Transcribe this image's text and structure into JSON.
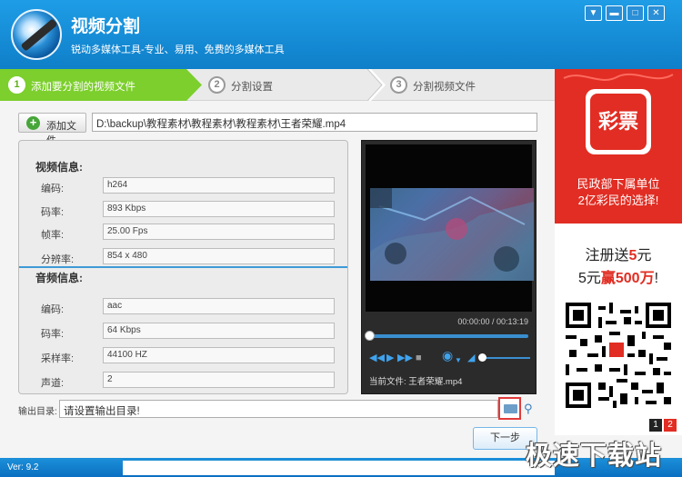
{
  "app": {
    "title": "视频分割",
    "subtitle": "锐动多媒体工具-专业、易用、免费的多媒体工具",
    "window_controls": [
      "menu-icon",
      "minimize-icon",
      "maximize-icon",
      "close-icon"
    ]
  },
  "steps": [
    {
      "num": "1",
      "label": "添加要分割的视频文件",
      "active": true
    },
    {
      "num": "2",
      "label": "分割设置",
      "active": false
    },
    {
      "num": "3",
      "label": "分割视频文件",
      "active": false
    }
  ],
  "toolbar": {
    "add_file_label": "添加文件",
    "file_path": "D:\\backup\\教程素材\\教程素材\\教程素材\\王者荣耀.mp4"
  },
  "video_info": {
    "title": "视频信息:",
    "rows": [
      {
        "label": "编码:",
        "value": "h264"
      },
      {
        "label": "码率:",
        "value": "893 Kbps"
      },
      {
        "label": "帧率:",
        "value": "25.00 Fps"
      },
      {
        "label": "分辨率:",
        "value": "854 x 480"
      }
    ]
  },
  "audio_info": {
    "title": "音频信息:",
    "rows": [
      {
        "label": "编码:",
        "value": "aac"
      },
      {
        "label": "码率:",
        "value": "64 Kbps"
      },
      {
        "label": "采样率:",
        "value": "44100 HZ"
      },
      {
        "label": "声道:",
        "value": "2"
      }
    ]
  },
  "player": {
    "time": "00:00:00 / 00:13:19",
    "progress": 0,
    "current_file": "当前文件: 王者荣耀.mp4"
  },
  "output": {
    "label": "输出目录:",
    "value": "请设置输出目录!"
  },
  "next_label": "下一步",
  "version": "Ver: 9.2",
  "watermark": "极速下载站",
  "ad": {
    "logo_text": "彩票",
    "line1": "民政部下属单位",
    "line2": "2亿彩民的选择!",
    "line3_pre": "注册送",
    "line3_red": "5",
    "line3_post": "元",
    "line4_pre": "5元",
    "line4_red": "赢500万",
    "line4_post": "!",
    "pages": [
      "1",
      "2"
    ]
  },
  "colors": {
    "titlebar": "#1287d4",
    "active_step": "#7ccf2c",
    "ad_red": "#e12d23"
  }
}
